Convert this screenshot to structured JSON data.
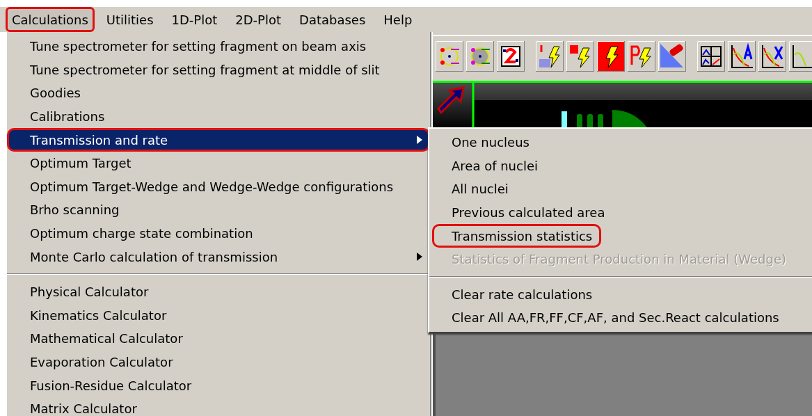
{
  "menu_bar": [
    {
      "label": "Calculations",
      "selected": true,
      "circled": true
    },
    {
      "label": "Utilities",
      "selected": false,
      "circled": false
    },
    {
      "label": "1D-Plot",
      "selected": false,
      "circled": false
    },
    {
      "label": "2D-Plot",
      "selected": false,
      "circled": false
    },
    {
      "label": "Databases",
      "selected": false,
      "circled": false
    },
    {
      "label": "Help",
      "selected": false,
      "circled": false
    }
  ],
  "calculations_menu": [
    {
      "kind": "item",
      "label": "Tune spectrometer for setting fragment on beam axis",
      "selected": false,
      "has_submenu": false,
      "circled": false
    },
    {
      "kind": "item",
      "label": "Tune spectrometer for setting fragment at middle of slit",
      "selected": false,
      "has_submenu": false,
      "circled": false
    },
    {
      "kind": "item",
      "label": "Goodies",
      "selected": false,
      "has_submenu": false,
      "circled": false
    },
    {
      "kind": "item",
      "label": "Calibrations",
      "selected": false,
      "has_submenu": false,
      "circled": false
    },
    {
      "kind": "item",
      "label": "Transmission and rate",
      "selected": true,
      "has_submenu": true,
      "circled": true
    },
    {
      "kind": "item",
      "label": "Optimum Target",
      "selected": false,
      "has_submenu": false,
      "circled": false
    },
    {
      "kind": "item",
      "label": "Optimum Target-Wedge and Wedge-Wedge configurations",
      "selected": false,
      "has_submenu": false,
      "circled": false
    },
    {
      "kind": "item",
      "label": "Brho scanning",
      "selected": false,
      "has_submenu": false,
      "circled": false
    },
    {
      "kind": "item",
      "label": "Optimum charge state combination",
      "selected": false,
      "has_submenu": false,
      "circled": false
    },
    {
      "kind": "item",
      "label": "Monte Carlo calculation of transmission",
      "selected": false,
      "has_submenu": true,
      "circled": false
    },
    {
      "kind": "separator"
    },
    {
      "kind": "item",
      "label": "Physical Calculator",
      "selected": false,
      "has_submenu": false,
      "circled": false
    },
    {
      "kind": "item",
      "label": "Kinematics Calculator",
      "selected": false,
      "has_submenu": false,
      "circled": false
    },
    {
      "kind": "item",
      "label": "Mathematical Calculator",
      "selected": false,
      "has_submenu": false,
      "circled": false
    },
    {
      "kind": "item",
      "label": "Evaporation Calculator",
      "selected": false,
      "has_submenu": false,
      "circled": false
    },
    {
      "kind": "item",
      "label": "Fusion-Residue Calculator",
      "selected": false,
      "has_submenu": false,
      "circled": false
    },
    {
      "kind": "item",
      "label": "Matrix Calculator",
      "selected": false,
      "has_submenu": false,
      "circled": false
    }
  ],
  "transmission_submenu": [
    {
      "kind": "item",
      "label": "One nucleus",
      "disabled": false,
      "circled": false
    },
    {
      "kind": "item",
      "label": "Area of nuclei",
      "disabled": false,
      "circled": false
    },
    {
      "kind": "item",
      "label": "All nuclei",
      "disabled": false,
      "circled": false
    },
    {
      "kind": "item",
      "label": "Previous calculated area",
      "disabled": false,
      "circled": false
    },
    {
      "kind": "item",
      "label": "Transmission statistics",
      "disabled": false,
      "circled": true
    },
    {
      "kind": "item",
      "label": "Statistics of Fragment Production in Material (Wedge)",
      "disabled": true,
      "circled": false
    },
    {
      "kind": "separator"
    },
    {
      "kind": "item",
      "label": "Clear rate calculations",
      "disabled": false,
      "circled": false
    },
    {
      "kind": "item",
      "label": "Clear All AA,FR,FF,CF,AF, and Sec.React calculations",
      "disabled": false,
      "circled": false
    }
  ]
}
